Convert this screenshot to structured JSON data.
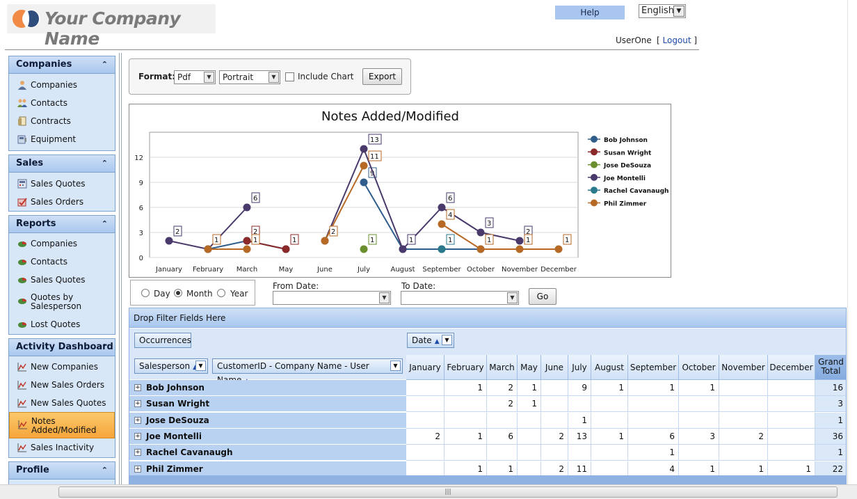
{
  "header": {
    "company_name": "Your Company Name",
    "help_label": "Help",
    "language": "English",
    "user_name": "UserOne",
    "logout_label": "Logout"
  },
  "sidebar": {
    "panels": [
      {
        "title": "Companies",
        "items": [
          "Companies",
          "Contacts",
          "Contracts",
          "Equipment"
        ]
      },
      {
        "title": "Sales",
        "items": [
          "Sales Quotes",
          "Sales Orders"
        ]
      },
      {
        "title": "Reports",
        "items": [
          "Companies",
          "Contacts",
          "Sales Quotes",
          "Quotes by Salesperson",
          "Lost Quotes"
        ]
      },
      {
        "title": "Activity Dashboard",
        "items": [
          "New Companies",
          "New Sales Orders",
          "New Sales Quotes",
          "Notes Added/Modified",
          "Sales Inactivity"
        ]
      },
      {
        "title": "Profile",
        "items": []
      }
    ],
    "active_item": "Notes Added/Modified"
  },
  "export": {
    "format_label": "Format:",
    "format_value": "Pdf",
    "orientation_value": "Portrait",
    "include_chart_label": "Include Chart",
    "export_label": "Export"
  },
  "chart_data": {
    "type": "line",
    "title": "Notes Added/Modified",
    "categories": [
      "January",
      "February",
      "March",
      "May",
      "June",
      "July",
      "August",
      "September",
      "October",
      "November",
      "December"
    ],
    "ylim": [
      0,
      15
    ],
    "yticks": [
      0,
      3,
      6,
      9,
      12
    ],
    "grid": true,
    "legend_position": "right",
    "series": [
      {
        "name": "Bob Johnson",
        "color": "#2f5d8c",
        "values": [
          null,
          1,
          2,
          1,
          null,
          9,
          1,
          1,
          1,
          null,
          null
        ]
      },
      {
        "name": "Susan Wright",
        "color": "#8b2a2a",
        "values": [
          null,
          null,
          2,
          1,
          null,
          null,
          null,
          null,
          null,
          null,
          null
        ]
      },
      {
        "name": "Jose DeSouza",
        "color": "#6b8e2f",
        "values": [
          null,
          null,
          null,
          null,
          null,
          1,
          null,
          null,
          null,
          null,
          null
        ]
      },
      {
        "name": "Joe Montelli",
        "color": "#4a3a6b",
        "values": [
          2,
          1,
          6,
          null,
          2,
          13,
          1,
          6,
          3,
          2,
          null
        ]
      },
      {
        "name": "Rachel Cavanaugh",
        "color": "#2a7a8c",
        "values": [
          null,
          null,
          null,
          null,
          null,
          null,
          null,
          1,
          null,
          null,
          null
        ]
      },
      {
        "name": "Phil Zimmer",
        "color": "#b66a26",
        "values": [
          null,
          1,
          1,
          null,
          2,
          11,
          null,
          4,
          1,
          1,
          1
        ]
      }
    ]
  },
  "date_filter": {
    "period_options": [
      "Day",
      "Month",
      "Year"
    ],
    "selected_period": "Month",
    "from_label": "From Date:",
    "to_label": "To Date:",
    "from_value": "",
    "to_value": "",
    "go_label": "Go"
  },
  "pivot": {
    "drop_filter_label": "Drop Filter Fields Here",
    "data_field": "Occurrences",
    "column_field": "Date",
    "row_fields": [
      "Salesperson",
      "CustomerID - Company Name - User Name"
    ],
    "months": [
      "January",
      "February",
      "March",
      "May",
      "June",
      "July",
      "August",
      "September",
      "October",
      "November",
      "December"
    ],
    "grand_total_label": "Grand Total",
    "rows": [
      {
        "name": "Bob Johnson",
        "cells": [
          "",
          "1",
          "2",
          "1",
          "",
          "9",
          "1",
          "1",
          "1",
          "",
          ""
        ],
        "total": "16"
      },
      {
        "name": "Susan Wright",
        "cells": [
          "",
          "",
          "2",
          "1",
          "",
          "",
          "",
          "",
          "",
          "",
          ""
        ],
        "total": "3"
      },
      {
        "name": "Jose DeSouza",
        "cells": [
          "",
          "",
          "",
          "",
          "",
          "1",
          "",
          "",
          "",
          "",
          ""
        ],
        "total": "1"
      },
      {
        "name": "Joe Montelli",
        "cells": [
          "2",
          "1",
          "6",
          "",
          "2",
          "13",
          "1",
          "6",
          "3",
          "2",
          ""
        ],
        "total": "36"
      },
      {
        "name": "Rachel Cavanaugh",
        "cells": [
          "",
          "",
          "",
          "",
          "",
          "",
          "",
          "1",
          "",
          "",
          ""
        ],
        "total": "1"
      },
      {
        "name": "Phil Zimmer",
        "cells": [
          "",
          "1",
          "1",
          "",
          "2",
          "11",
          "",
          "4",
          "1",
          "1",
          "1"
        ],
        "total": "22"
      }
    ]
  }
}
